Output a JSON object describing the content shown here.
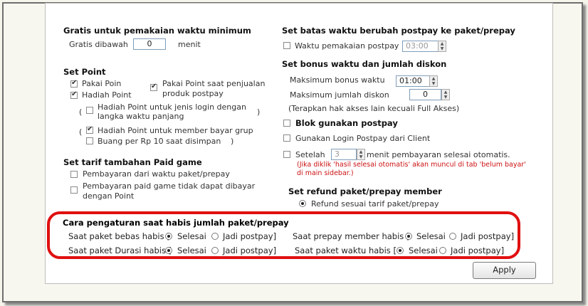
{
  "left": {
    "min_time": {
      "heading": "Gratis untuk pemakaian waktu minimum",
      "free_below_label": "Gratis dibawah",
      "free_below_value": "0",
      "minute_label": "menit"
    },
    "point": {
      "heading": "Set Point",
      "use_point": "Pakai Poin",
      "gift_point": "Hadiah Point",
      "use_point_postpay": "Pakai Point saat penjualan produk postpay",
      "gift_point_login_types": "Hadiah Point untuk jenis login dengan langka waktu panjang",
      "gift_point_member": "Hadiah Point untuk member bayar grup",
      "discard_point": "Buang per Rp 10 saat disimpan",
      "paren_open": "(",
      "paren_close": ")"
    },
    "paid_game": {
      "heading": "Set tarif tambahan Paid game",
      "opt1": "Pembayaran dari waktu paket/prepay",
      "opt2": "Pembayaran paid game tidak dapat dibayar dengan Point"
    }
  },
  "right": {
    "postpay_limit": {
      "heading": "Set batas waktu berubah postpay ke paket/prepay",
      "usage_label": "Waktu pemakaian postpay",
      "usage_value": "03:00"
    },
    "bonus": {
      "heading": "Set bonus waktu dan jumlah diskon",
      "max_bonus_label": "Maksimum bonus waktu",
      "max_bonus_value": "01:00",
      "max_discount_label": "Maksimum jumlah diskon",
      "max_discount_value": "0",
      "note": "(Terapkan hak akses lain kecuali Full Akses)"
    },
    "block_postpay": "Blok gunakan postpay",
    "login_postpay_client": "Gunakan Login Postpay dari Client",
    "after_label": "Setelah",
    "after_value": "3",
    "after_suffix": "menit pembayaran selesai otomatis.",
    "red_note_1": "(Jika diklik 'hasil selesai otomatis' akan muncul di tab 'belum bayar'",
    "red_note_2": "di main sidebar.)",
    "refund": {
      "heading": "Set refund paket/prepay member",
      "option": "Refund sesuai tarif paket/prepay"
    }
  },
  "exhausted": {
    "heading": "Cara pengaturan saat habis jumlah paket/prepay",
    "rows": [
      {
        "label": "Saat paket bebas habis [",
        "opt_done": "Selesai",
        "opt_postpay": "Jadi postpay]"
      },
      {
        "label": "Saat paket Durasi habis [",
        "opt_done": "Selesai",
        "opt_postpay": "Jadi postpay]"
      },
      {
        "label": "Saat prepay member habis [",
        "opt_done": "Selesai",
        "opt_postpay": "Jadi postpay]"
      },
      {
        "label": "Saat paket waktu habis [",
        "opt_done": "Selesai",
        "opt_postpay": "Jadi postpay]"
      }
    ]
  },
  "apply_label": "Apply",
  "colors": {
    "highlight": "#e01010",
    "note_red": "#cc1111"
  }
}
